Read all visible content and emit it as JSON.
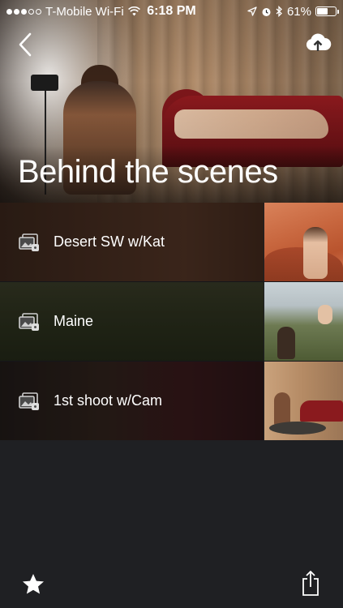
{
  "status_bar": {
    "carrier": "T-Mobile Wi-Fi",
    "time": "6:18 PM",
    "battery_text": "61%",
    "battery_level": 0.61,
    "signal_bars_filled": 3,
    "signal_bars_total": 5
  },
  "header": {
    "title": "Behind the scenes",
    "back_icon": "chevron-left-icon",
    "cloud_icon": "cloud-upload-icon"
  },
  "albums": [
    {
      "name": "Desert SW w/Kat",
      "icon": "shared-album-icon"
    },
    {
      "name": "Maine",
      "icon": "shared-album-icon"
    },
    {
      "name": "1st shoot w/Cam",
      "icon": "shared-album-icon"
    }
  ],
  "toolbar": {
    "favorite_icon": "star-icon",
    "share_icon": "share-icon"
  },
  "colors": {
    "background": "#1f2023",
    "text": "#ffffff",
    "separator": "#15161a"
  }
}
